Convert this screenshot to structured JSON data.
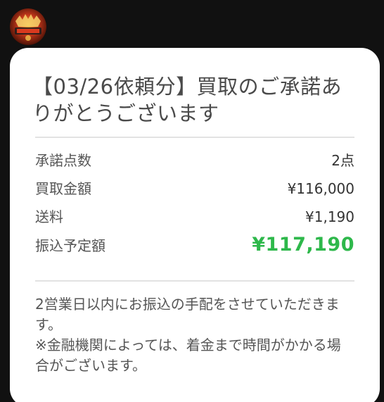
{
  "message": {
    "title": "【03/26依頼分】買取のご承諾ありがとうございます",
    "rows": [
      {
        "label": "承諾点数",
        "value": "2点"
      },
      {
        "label": "買取金額",
        "value": "¥116,000"
      },
      {
        "label": "送料",
        "value": "¥1,190"
      },
      {
        "label": "振込予定額",
        "value": "¥117,190"
      }
    ],
    "note": "2営業日以内にお振込の手配をさせていただきます。",
    "disclaimer": "※金融機関によっては、着金まで時間がかかる場合がございます。",
    "colors": {
      "total": "#2eb84b",
      "card_bg": "#ffffff",
      "screen_bg": "#111111"
    }
  },
  "avatar": {
    "icon": "store-logo-icon"
  }
}
